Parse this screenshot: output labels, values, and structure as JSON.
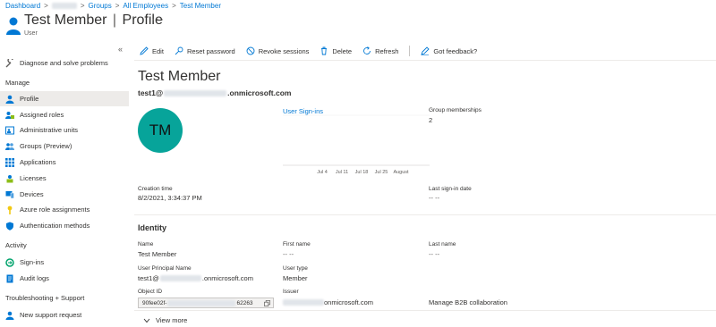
{
  "breadcrumb": {
    "items": [
      "Dashboard",
      "Groups",
      "All Employees",
      "Test Member"
    ]
  },
  "header": {
    "title": "Test Member",
    "separator": "|",
    "page": "Profile",
    "more": "···",
    "subtitle": "User"
  },
  "sidebar": {
    "collapse_icon": "«",
    "items": [
      {
        "label": "Diagnose and solve problems",
        "icon": "wrench-icon"
      },
      {
        "label": "Profile",
        "icon": "person-icon",
        "active": true
      },
      {
        "label": "Assigned roles",
        "icon": "roles-icon"
      },
      {
        "label": "Administrative units",
        "icon": "admin-units-icon"
      },
      {
        "label": "Groups (Preview)",
        "icon": "groups-icon"
      },
      {
        "label": "Applications",
        "icon": "apps-grid-icon"
      },
      {
        "label": "Licenses",
        "icon": "license-icon"
      },
      {
        "label": "Devices",
        "icon": "device-icon"
      },
      {
        "label": "Azure role assignments",
        "icon": "key-icon"
      },
      {
        "label": "Authentication methods",
        "icon": "shield-icon"
      },
      {
        "label": "Sign-ins",
        "icon": "signin-icon"
      },
      {
        "label": "Audit logs",
        "icon": "audit-log-icon"
      },
      {
        "label": "New support request",
        "icon": "support-person-icon"
      }
    ],
    "sections": {
      "manage": "Manage",
      "activity": "Activity",
      "troubleshooting": "Troubleshooting + Support"
    }
  },
  "toolbar": {
    "edit": "Edit",
    "reset_password": "Reset password",
    "revoke_sessions": "Revoke sessions",
    "delete": "Delete",
    "refresh": "Refresh",
    "feedback": "Got feedback?"
  },
  "profile": {
    "display_name": "Test Member",
    "upn_prefix": "test1@",
    "upn_suffix": ".onmicrosoft.com",
    "avatar_initials": "TM",
    "avatar_color": "#07a49a"
  },
  "chart_data": {
    "type": "line",
    "title": "User Sign-ins",
    "x": [
      "Jul 4",
      "Jul 11",
      "Jul 18",
      "Jul 25",
      "August"
    ],
    "series": [
      {
        "values": [
          0,
          0,
          0,
          0,
          0
        ]
      }
    ],
    "grid": true
  },
  "stats": {
    "group_memberships_label": "Group memberships",
    "group_memberships_value": "2",
    "creation_time_label": "Creation time",
    "creation_time_value": "8/2/2021, 3:34:37 PM",
    "last_signin_label": "Last sign-in date",
    "last_signin_value": "-- --"
  },
  "identity": {
    "heading": "Identity",
    "name_label": "Name",
    "name_value": "Test Member",
    "first_name_label": "First name",
    "first_name_value": "-- --",
    "last_name_label": "Last name",
    "last_name_value": "-- --",
    "upn_label": "User Principal Name",
    "upn_prefix": "test1@",
    "upn_suffix": ".onmicrosoft.com",
    "user_type_label": "User type",
    "user_type_value": "Member",
    "object_id_label": "Object ID",
    "object_id_prefix": "90fee02f-",
    "object_id_suffix": "62263",
    "issuer_label": "Issuer",
    "issuer_suffix": "onmicrosoft.com",
    "b2b_link": "Manage B2B collaboration"
  },
  "view_more": "View more",
  "colors": {
    "accent": "#0078d4",
    "active_bg": "#edebe9"
  }
}
